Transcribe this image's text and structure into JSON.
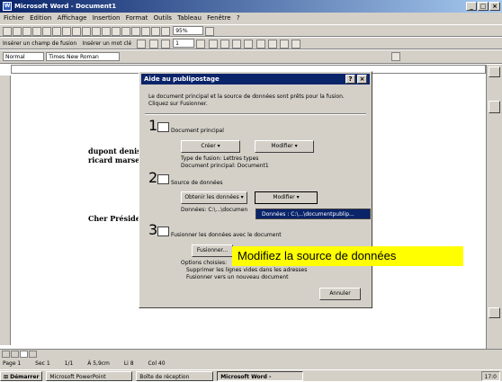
{
  "window": {
    "title": "Microsoft Word - Document1",
    "app_icon": "W"
  },
  "menu": [
    "Fichier",
    "Edition",
    "Affichage",
    "Insertion",
    "Format",
    "Outils",
    "Tableau",
    "Fenêtre",
    "?"
  ],
  "toolbar1": {
    "zoom": "95%"
  },
  "toolbar2": {
    "insert_field": "Insérer un champ de fusion",
    "insert_word": "Insérer un mot clé",
    "record": "1"
  },
  "toolbar3": {
    "style": "Normal",
    "font": "Times New Roman"
  },
  "document": {
    "line1": "dupont  denis",
    "line2": "ricard marseille",
    "line3": "Cher Président, je"
  },
  "dialog": {
    "title": "Aide au publipostage",
    "help": "?",
    "close": "×",
    "intro": "Le document principal et la source de données sont prêts pour la fusion. Cliquez sur Fusionner.",
    "step1": {
      "num": "1",
      "label": "Document principal",
      "create": "Créer",
      "edit": "Modifier",
      "info1": "Type de fusion: Lettres types",
      "info2": "Document principal: Document1"
    },
    "step2": {
      "num": "2",
      "label": "Source de données",
      "get": "Obtenir les données",
      "edit": "Modifier",
      "data": "Données: C:\\...\\documen"
    },
    "step3": {
      "num": "3",
      "label": "Fusionner les données avec le document",
      "merge": "Fusionner...",
      "options_title": "Options choisies:",
      "opt1": "Supprimer les lignes vides dans les adresses",
      "opt2": "Fusionner vers un nouveau document"
    },
    "cancel": "Annuler"
  },
  "dropdown": {
    "item": "Données : C:\\...\\documentpublip..."
  },
  "tooltip": {
    "text": "Modifiez la source de données"
  },
  "status": {
    "page": "Page 1",
    "section": "Sec 1",
    "pages": "1/1",
    "at": "À 5,9cm",
    "line": "Li 8",
    "col": "Col 40"
  },
  "taskbar": {
    "start": "Démarrer",
    "t1": "Microsoft PowerPoint",
    "t2": "Boîte de réception",
    "t3": "Microsoft Word -",
    "clock": "17:0"
  }
}
